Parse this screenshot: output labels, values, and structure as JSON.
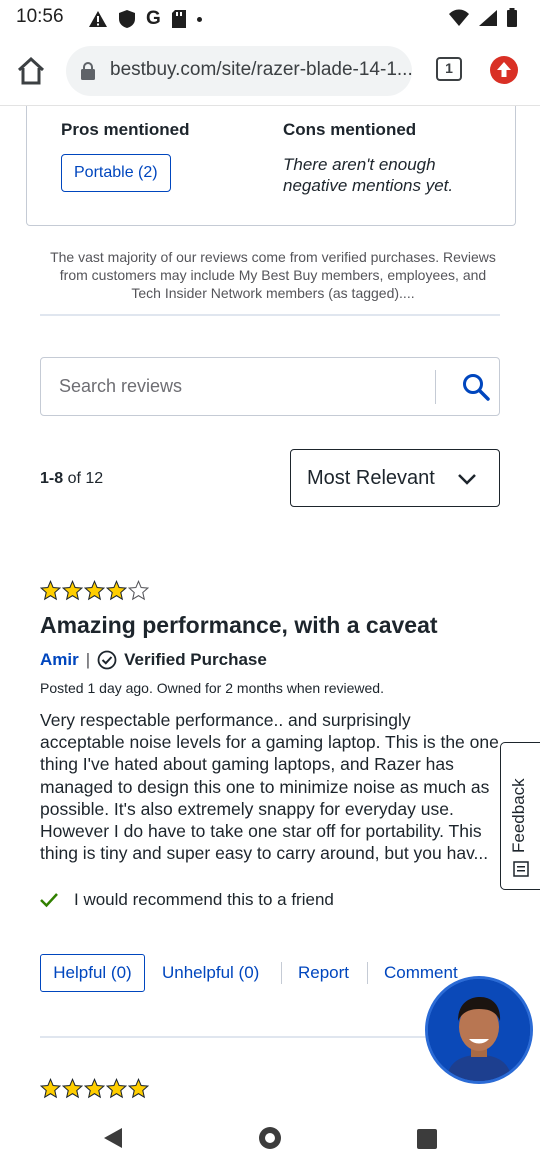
{
  "status_bar": {
    "time": "10:56"
  },
  "browser": {
    "url": "bestbuy.com/site/razer-blade-14-1...",
    "tab_count": "1"
  },
  "pros_cons": {
    "pros_title": "Pros mentioned",
    "cons_title": "Cons mentioned",
    "pros": [
      "Portable (2)"
    ],
    "cons_text": "There aren't enough negative mentions yet."
  },
  "disclaimer": "The vast majority of our reviews come from verified purchases. Reviews from customers may include My Best Buy members, employees, and Tech Insider Network members (as tagged)....",
  "search": {
    "placeholder": "Search reviews"
  },
  "results": {
    "range": "1-8",
    "of_total": "of 12"
  },
  "sort": {
    "selected": "Most Relevant"
  },
  "review": {
    "rating": 4,
    "title": "Amazing performance, with a caveat",
    "author": "Amir",
    "separator": "|",
    "verified": "Verified Purchase",
    "posted": "Posted 1 day ago. Owned for 2 months when reviewed.",
    "body": "Very respectable performance.. and surprisingly acceptable noise levels for a gaming laptop. This is the one thing I've hated about gaming laptops, and Razer has managed to design this one to minimize noise as much as possible. It's also extremely snappy for everyday use. However I do have to take one star off for portability. This thing is tiny and super easy to carry around, but you hav...",
    "recommend": "I would recommend this to a friend",
    "helpful": "Helpful (0)",
    "unhelpful": "Unhelpful (0)",
    "report": "Report",
    "comment": "Comment"
  },
  "next_review": {
    "rating": 5
  },
  "feedback": "Feedback",
  "colors": {
    "accent": "#0046be",
    "star": "#ffce00",
    "check": "#318000"
  }
}
